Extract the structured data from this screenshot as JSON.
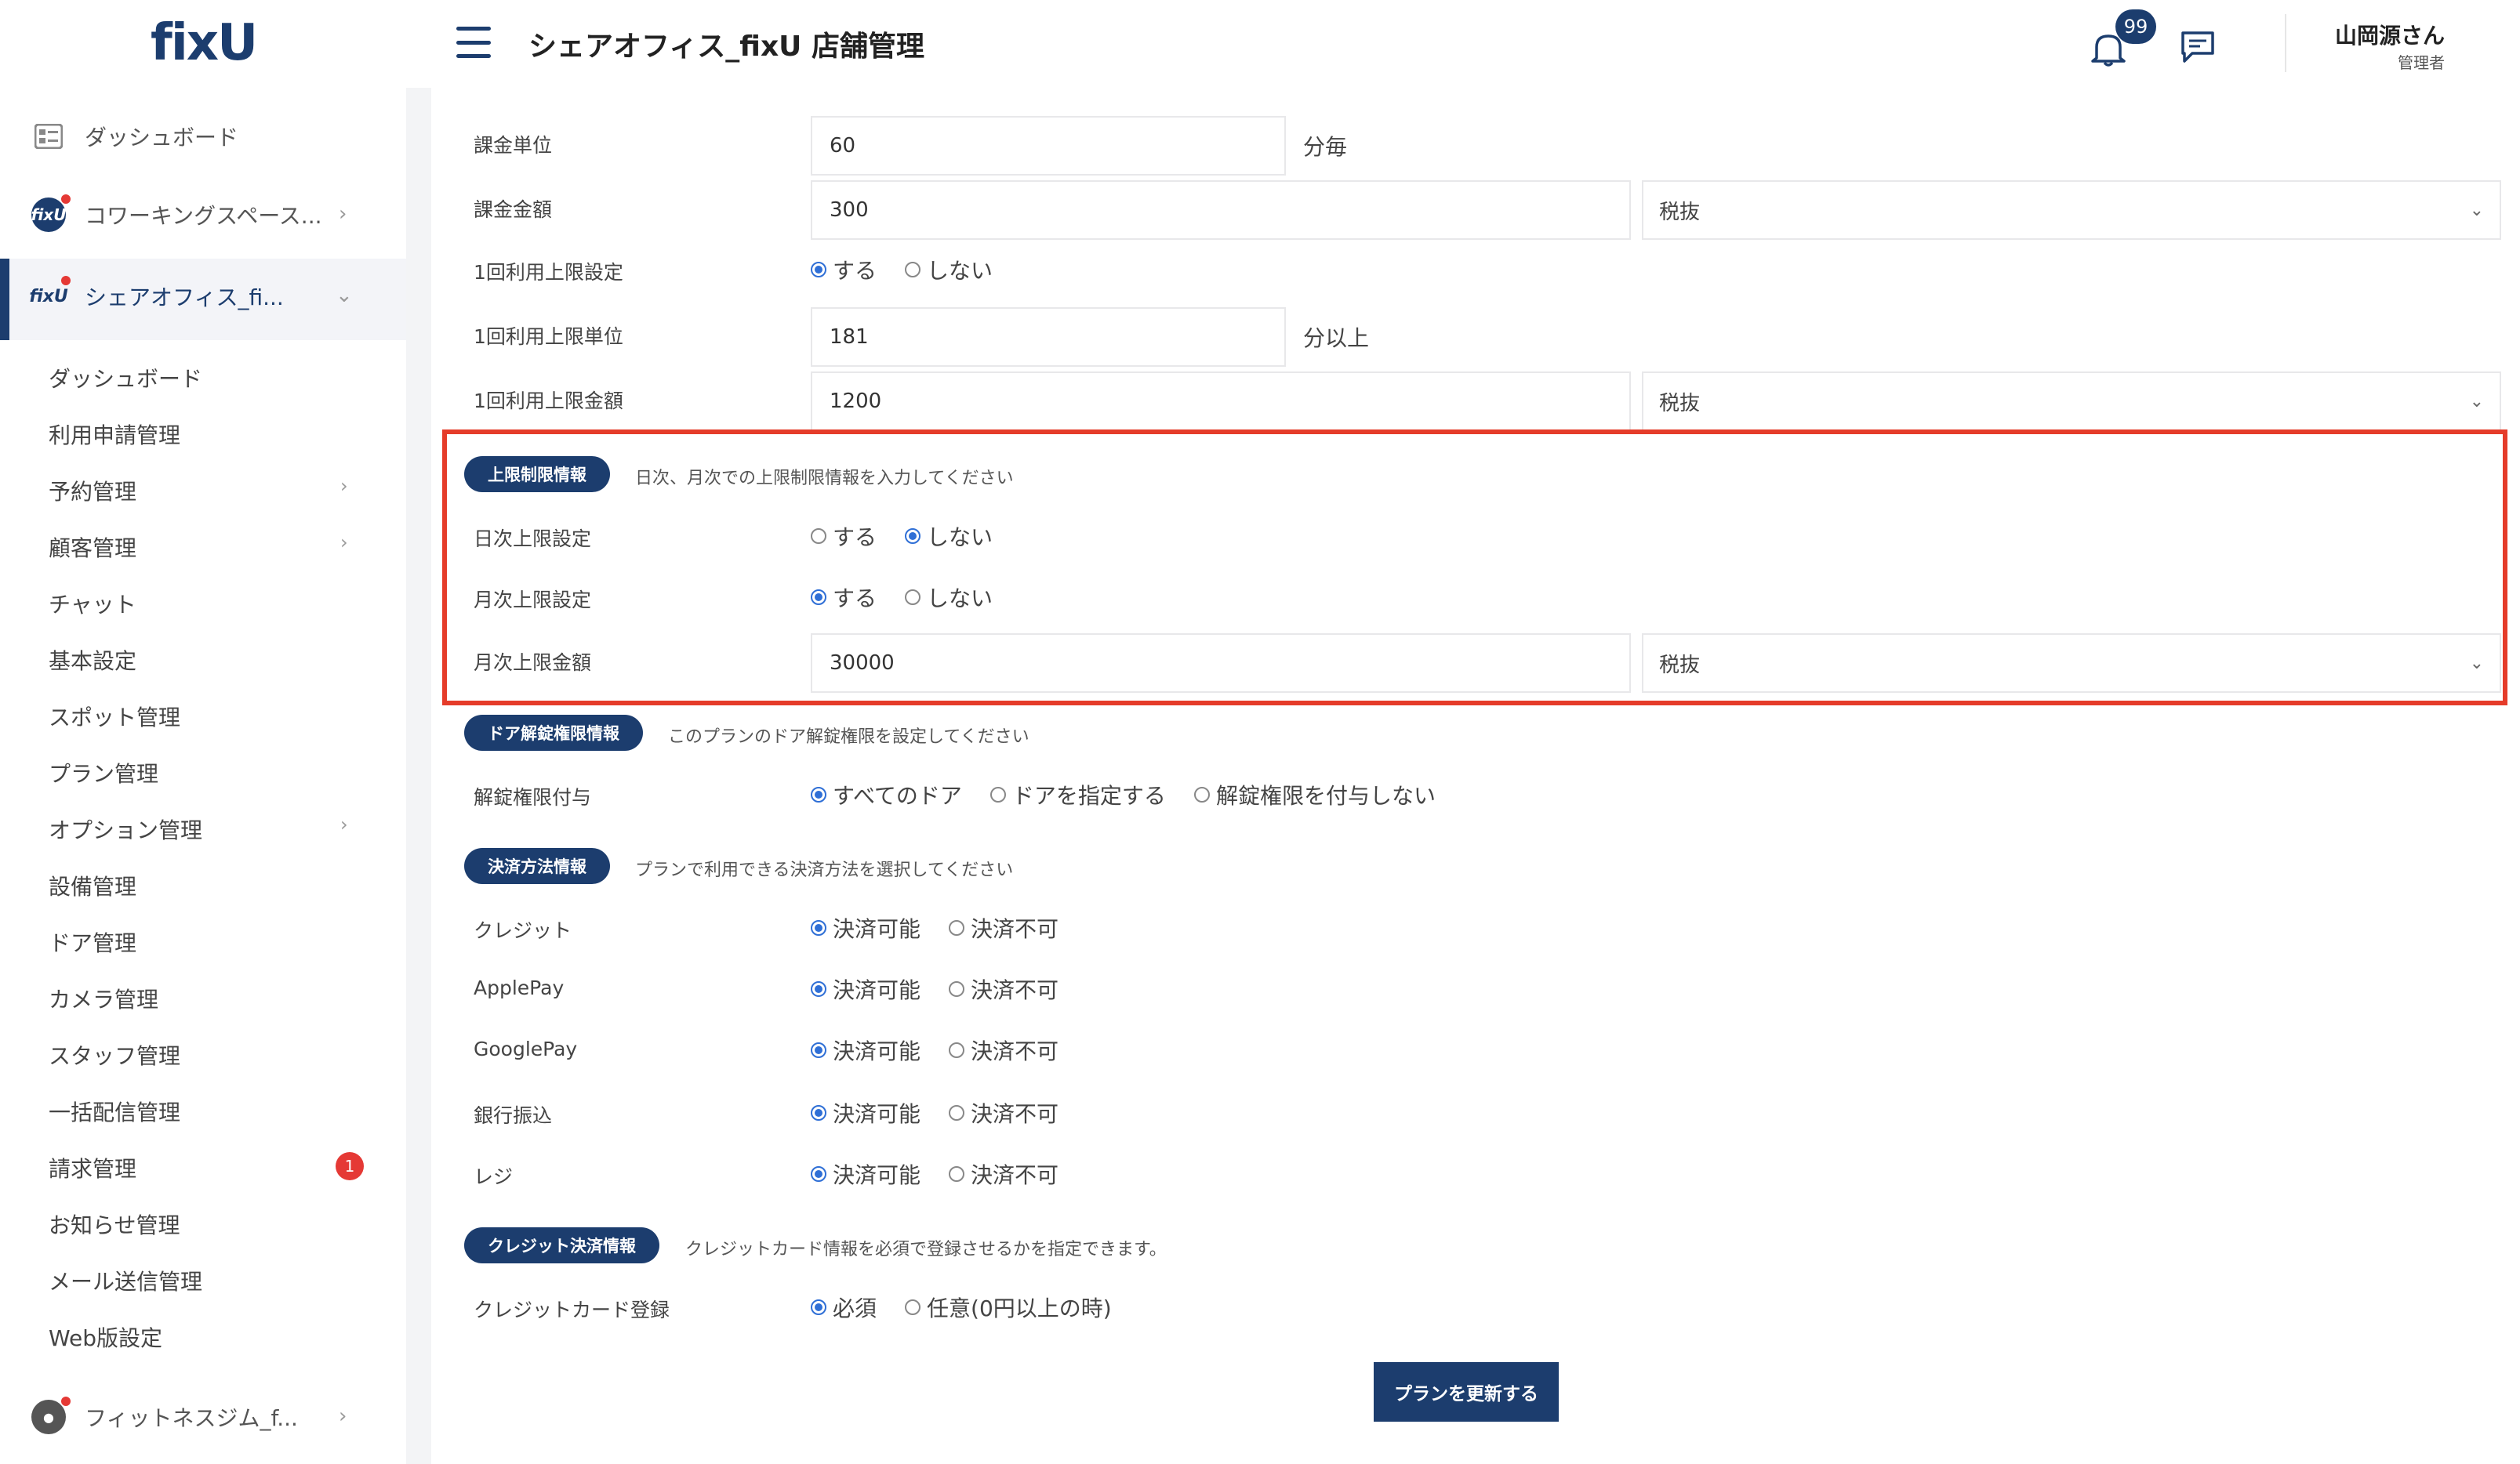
{
  "sidebar": {
    "logo": "fixU",
    "top_items": [
      {
        "label": "ダッシュボード"
      },
      {
        "label": "コワーキングスペース..."
      },
      {
        "label": "シェアオフィス_fi..."
      }
    ],
    "fixu_icon_text": "fixU",
    "sub_items": [
      {
        "label": "ダッシュボード"
      },
      {
        "label": "利用申請管理"
      },
      {
        "label": "予約管理"
      },
      {
        "label": "顧客管理"
      },
      {
        "label": "チャット"
      },
      {
        "label": "基本設定"
      },
      {
        "label": "スポット管理"
      },
      {
        "label": "プラン管理"
      },
      {
        "label": "オプション管理"
      },
      {
        "label": "設備管理"
      },
      {
        "label": "ドア管理"
      },
      {
        "label": "カメラ管理"
      },
      {
        "label": "スタッフ管理"
      },
      {
        "label": "一括配信管理"
      },
      {
        "label": "請求管理",
        "badge": "1"
      },
      {
        "label": "お知らせ管理"
      },
      {
        "label": "メール送信管理"
      },
      {
        "label": "Web版設定"
      }
    ],
    "bottom_item": {
      "label": "フィットネスジム_f..."
    }
  },
  "header": {
    "title": "シェアオフィス_fixU 店舗管理",
    "notification_count": "99",
    "user_name": "山岡源さん",
    "user_role": "管理者"
  },
  "form": {
    "billing_unit": {
      "label": "課金単位",
      "value": "60",
      "unit": "分毎"
    },
    "billing_amount": {
      "label": "課金金額",
      "value": "300",
      "tax": "税抜"
    },
    "single_limit": {
      "label": "1回利用上限設定",
      "options": [
        "する",
        "しない"
      ],
      "selected": "する"
    },
    "single_limit_unit": {
      "label": "1回利用上限単位",
      "value": "181",
      "unit": "分以上"
    },
    "single_limit_amount": {
      "label": "1回利用上限金額",
      "value": "1200",
      "tax": "税抜"
    },
    "limit_section": {
      "pill": "上限制限情報",
      "desc": "日次、月次での上限制限情報を入力してください",
      "daily": {
        "label": "日次上限設定",
        "options": [
          "する",
          "しない"
        ],
        "selected": "しない"
      },
      "monthly": {
        "label": "月次上限設定",
        "options": [
          "する",
          "しない"
        ],
        "selected": "する"
      },
      "monthly_amount": {
        "label": "月次上限金額",
        "value": "30000",
        "tax": "税抜"
      }
    },
    "door_section": {
      "pill": "ドア解錠権限情報",
      "desc": "このプランのドア解錠権限を設定してください",
      "unlock": {
        "label": "解錠権限付与",
        "options": [
          "すべてのドア",
          "ドアを指定する",
          "解錠権限を付与しない"
        ],
        "selected": "すべてのドア"
      }
    },
    "payment_section": {
      "pill": "決済方法情報",
      "desc": "プランで利用できる決済方法を選択してください",
      "methods": [
        {
          "label": "クレジット",
          "options": [
            "決済可能",
            "決済不可"
          ],
          "selected": "決済可能"
        },
        {
          "label": "ApplePay",
          "options": [
            "決済可能",
            "決済不可"
          ],
          "selected": "決済可能"
        },
        {
          "label": "GooglePay",
          "options": [
            "決済可能",
            "決済不可"
          ],
          "selected": "決済可能"
        },
        {
          "label": "銀行振込",
          "options": [
            "決済可能",
            "決済不可"
          ],
          "selected": "決済可能"
        },
        {
          "label": "レジ",
          "options": [
            "決済可能",
            "決済不可"
          ],
          "selected": "決済可能"
        }
      ]
    },
    "credit_section": {
      "pill": "クレジット決済情報",
      "desc": "クレジットカード情報を必須で登録させるかを指定できます。",
      "card": {
        "label": "クレジットカード登録",
        "options": [
          "必須",
          "任意(0円以上の時)"
        ],
        "selected": "必須"
      }
    },
    "submit_label": "プランを更新する"
  },
  "colors": {
    "brand": "#1c3d6e",
    "highlight": "#e53c2a",
    "radio_on": "#2f6fd6",
    "badge": "#e53935"
  }
}
